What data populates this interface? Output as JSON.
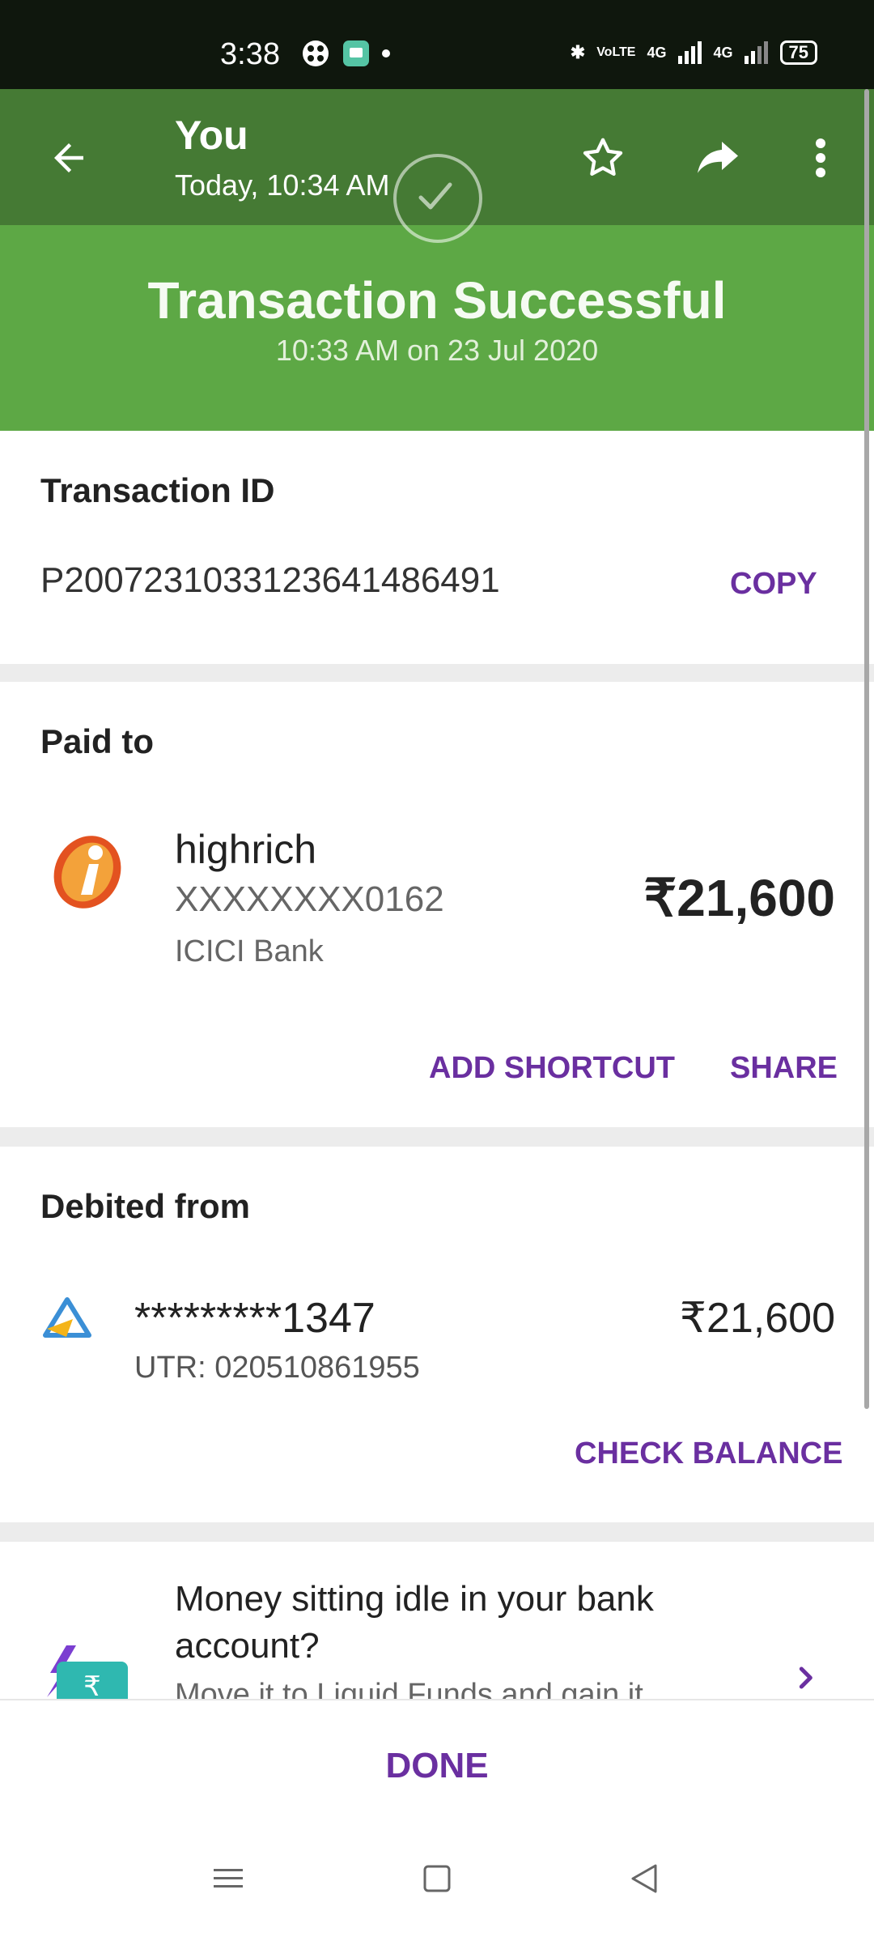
{
  "status_bar": {
    "time": "3:38",
    "network_label_1": "VoLTE",
    "network_label_2": "4G",
    "network_label_3": "4G",
    "battery": "75"
  },
  "header": {
    "title": "You",
    "subtitle": "Today, 10:34 AM"
  },
  "hero": {
    "title": "Transaction Successful",
    "subtitle": "10:33 AM on 23 Jul 2020"
  },
  "transaction": {
    "label": "Transaction ID",
    "id": "P2007231033123641486491",
    "copy_label": "COPY"
  },
  "paid_to": {
    "label": "Paid to",
    "name": "highrich",
    "account": "XXXXXXXX0162",
    "bank": "ICICI Bank",
    "amount": "₹21,600",
    "add_shortcut_label": "ADD SHORTCUT",
    "share_label": "SHARE"
  },
  "debited_from": {
    "label": "Debited from",
    "account": "*********1347",
    "utr": "UTR: 020510861955",
    "amount": "₹21,600",
    "check_balance_label": "CHECK BALANCE"
  },
  "promo": {
    "title_line1": "Money sitting idle in your bank",
    "title_line2": "account?",
    "subtext_partial": "Move it to Liquid Funds and gain it"
  },
  "footer": {
    "done_label": "DONE"
  },
  "colors": {
    "appbar": "#457a34",
    "hero": "#5da845",
    "accent": "#6a2fa0"
  }
}
